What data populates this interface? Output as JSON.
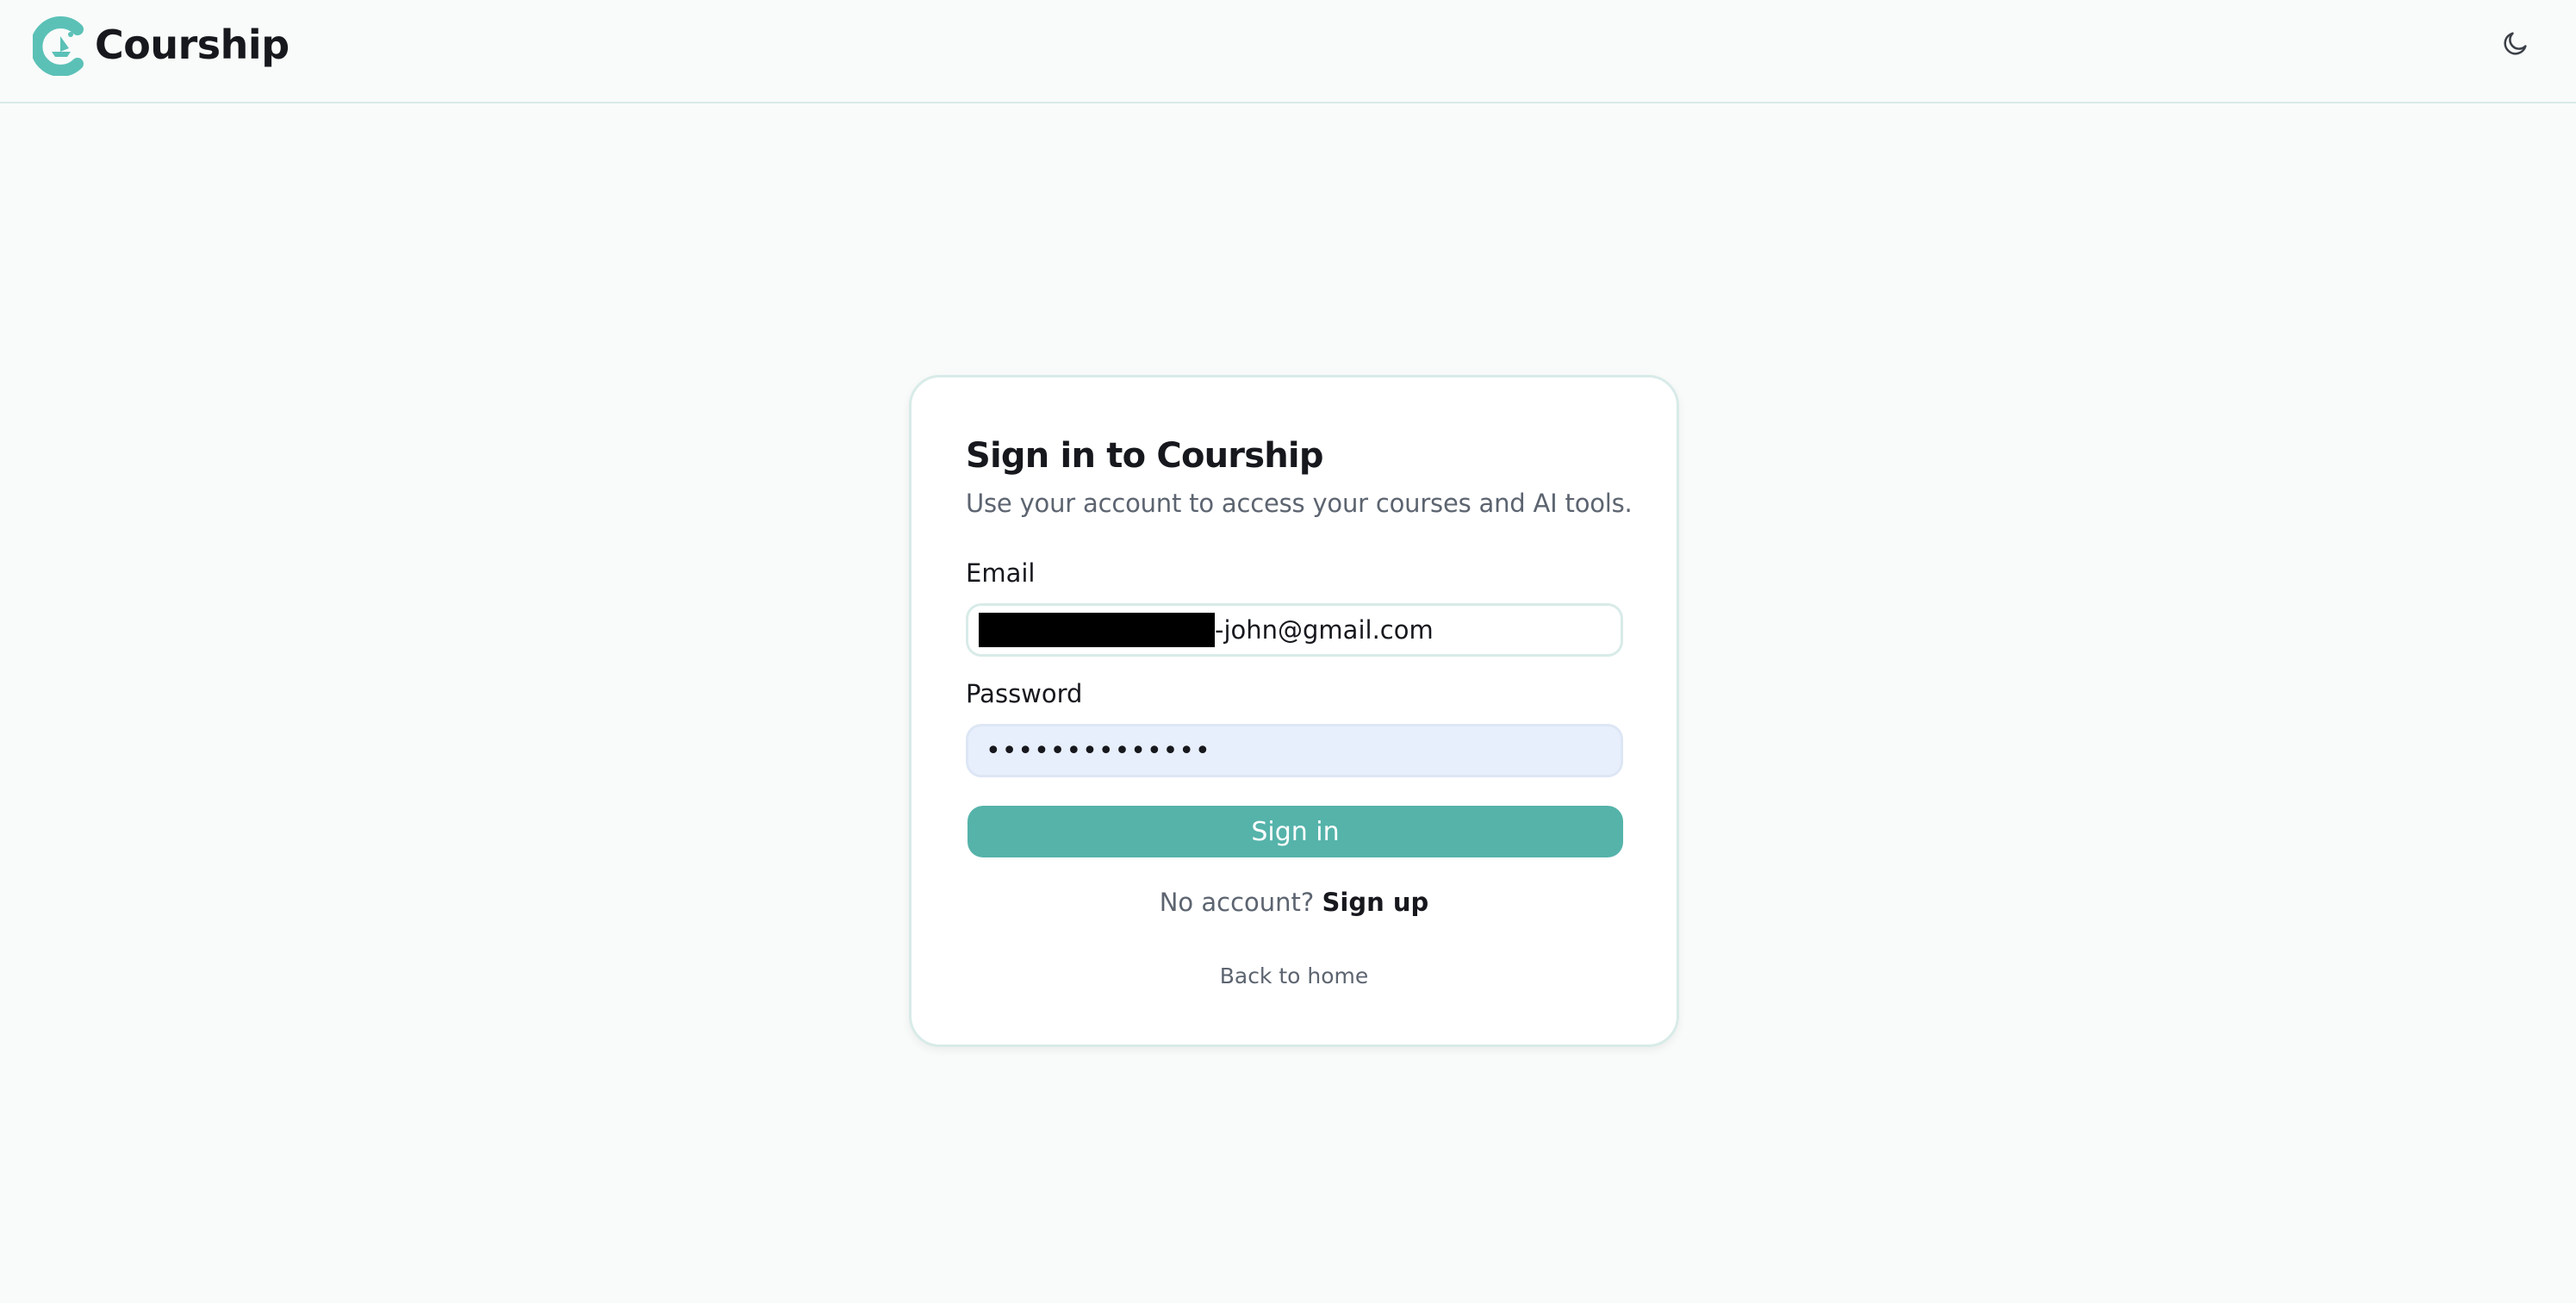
{
  "header": {
    "brand_name": "Courship",
    "brand_color": "#5bc1b7",
    "theme_toggle_icon": "moon-icon"
  },
  "signin": {
    "title": "Sign in to Courship",
    "subtitle": "Use your account to access your courses and AI tools.",
    "email_label": "Email",
    "email_value_visible": "-john@gmail.com",
    "password_label": "Password",
    "password_value": "••••••••••••••",
    "submit_label": "Sign in",
    "no_account_text": "No account?",
    "signup_link": "Sign up",
    "back_home": "Back to home",
    "accent_color": "#55b3aa"
  }
}
